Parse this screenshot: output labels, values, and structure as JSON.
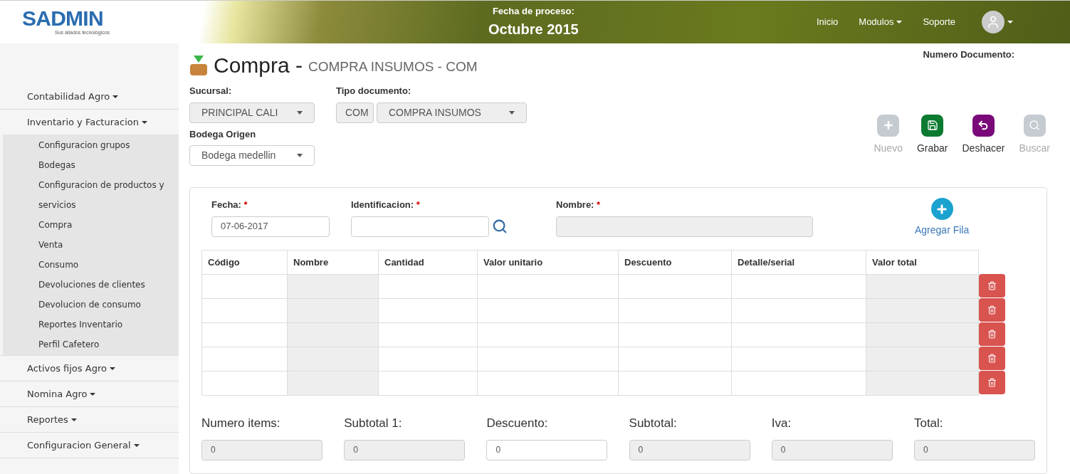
{
  "header": {
    "logo": {
      "name": "SADMIN",
      "tagline": "Sus aliados tecnológicos"
    },
    "process_label": "Fecha de proceso:",
    "process_date": "Octubre 2015",
    "nav": [
      {
        "label": "Inicio",
        "dropdown": false
      },
      {
        "label": "Modulos",
        "dropdown": true
      },
      {
        "label": "Soporte",
        "dropdown": false
      }
    ]
  },
  "sidebar": {
    "items": [
      {
        "label": "Contabilidad Agro"
      },
      {
        "label": "Inventario y Facturacion",
        "children": [
          {
            "label": "Configuracion grupos"
          },
          {
            "label": "Bodegas"
          },
          {
            "label": "Configuracion de productos y servicios"
          },
          {
            "label": "Compra"
          },
          {
            "label": "Venta"
          },
          {
            "label": "Consumo"
          },
          {
            "label": "Devoluciones de clientes"
          },
          {
            "label": "Devolucion de consumo"
          },
          {
            "label": "Reportes Inventario"
          },
          {
            "label": "Perfil Cafetero"
          }
        ]
      },
      {
        "label": "Activos fijos Agro"
      },
      {
        "label": "Nomina Agro"
      },
      {
        "label": "Reportes"
      },
      {
        "label": "Configuracion General"
      }
    ]
  },
  "page": {
    "title": "Compra -",
    "subtitle": "COMPRA INSUMOS - COM",
    "document_number_label": "Numero Documento:",
    "sucursal": {
      "label": "Sucursal:",
      "value": "PRINCIPAL CALI",
      "disabled": true
    },
    "tipo_documento": {
      "label": "Tipo documento:",
      "code": "COM",
      "value": "COMPRA INSUMOS",
      "disabled": true
    },
    "bodega": {
      "label": "Bodega Origen",
      "value": "Bodega medellin",
      "disabled": false
    },
    "toolbar": [
      {
        "kind": "add",
        "label": "Nuevo",
        "disabled": true
      },
      {
        "kind": "save",
        "label": "Grabar",
        "disabled": false
      },
      {
        "kind": "undo",
        "label": "Deshacer",
        "disabled": false
      },
      {
        "kind": "search",
        "label": "Buscar",
        "disabled": true
      }
    ]
  },
  "form": {
    "fecha": {
      "label": "Fecha:",
      "required_mark": "*",
      "value": "07-06-2017"
    },
    "identificacion": {
      "label": "Identificacion:",
      "required_mark": "*"
    },
    "nombre": {
      "label": "Nombre:",
      "required_mark": "*",
      "disabled": true
    },
    "add_row": "Agregar Fila"
  },
  "table": {
    "columns": [
      {
        "label": "Código",
        "disabled": false
      },
      {
        "label": "Nombre",
        "disabled": true
      },
      {
        "label": "Cantidad",
        "disabled": false
      },
      {
        "label": "Valor unitario",
        "disabled": false
      },
      {
        "label": "Descuento",
        "disabled": false
      },
      {
        "label": "Detalle/serial",
        "disabled": false
      },
      {
        "label": "Valor total",
        "disabled": true
      }
    ],
    "rows": [
      {
        "deletable": true
      },
      {
        "deletable": true
      },
      {
        "deletable": true
      },
      {
        "deletable": true
      },
      {
        "deletable": true
      }
    ]
  },
  "totals": [
    {
      "label": "Numero items:",
      "value": "0",
      "disabled": true
    },
    {
      "label": "Subtotal 1:",
      "value": "0",
      "disabled": true
    },
    {
      "label": "Descuento:",
      "value": "0",
      "disabled": false
    },
    {
      "label": "Subtotal:",
      "value": "0",
      "disabled": true
    },
    {
      "label": "Iva:",
      "value": "0",
      "disabled": true
    },
    {
      "label": "Total:",
      "value": "0",
      "disabled": true
    }
  ]
}
